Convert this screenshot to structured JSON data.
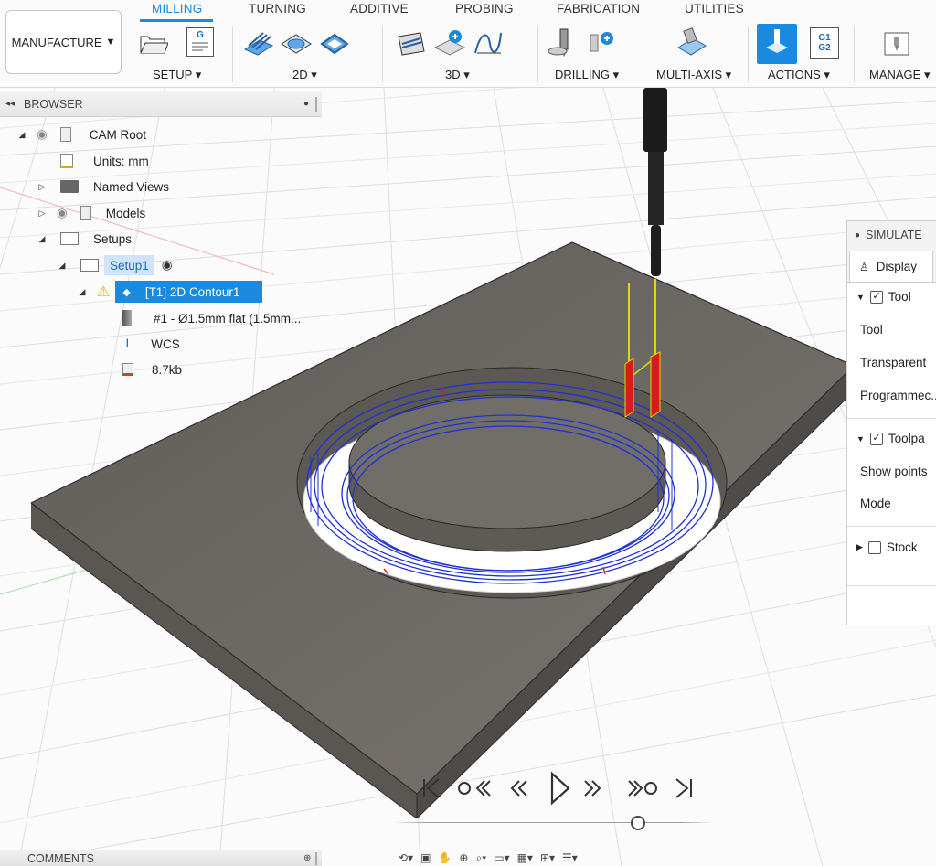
{
  "workspace": {
    "label": "MANUFACTURE"
  },
  "tabs": [
    {
      "label": "MILLING"
    },
    {
      "label": "TURNING"
    },
    {
      "label": "ADDITIVE"
    },
    {
      "label": "PROBING"
    },
    {
      "label": "FABRICATION"
    },
    {
      "label": "UTILITIES"
    }
  ],
  "groups": {
    "setup": "SETUP ▾",
    "twod": "2D ▾",
    "threed": "3D ▾",
    "drilling": "DRILLING ▾",
    "multiaxis": "MULTI-AXIS ▾",
    "actions": "ACTIONS ▾",
    "manage": "MANAGE ▾"
  },
  "icons": {
    "post_g": "G",
    "gcode": "G1 G2"
  },
  "browser": {
    "title": "BROWSER",
    "items": [
      {
        "label": "CAM Root"
      },
      {
        "label": "Units: mm"
      },
      {
        "label": "Named Views"
      },
      {
        "label": "Models"
      },
      {
        "label": "Setups"
      },
      {
        "label": "Setup1"
      },
      {
        "label": "[T1] 2D Contour1"
      },
      {
        "label": "#1 - Ø1.5mm flat (1.5mm..."
      },
      {
        "label": "WCS"
      },
      {
        "label": "8.7kb"
      }
    ]
  },
  "simulate": {
    "title": "SIMULATE",
    "tab": "Display",
    "tool_section": "Tool",
    "rows": [
      "Tool",
      "Transparent",
      "Programmec..."
    ],
    "toolpath_section": "Toolpa",
    "rows2": [
      "Show points",
      "Mode"
    ],
    "stock_section": "Stock",
    "tool_checked": true,
    "toolpath_checked": true,
    "stock_checked": false
  },
  "comments": {
    "label": "COMMENTS"
  },
  "colors": {
    "accent": "#1a8ae0",
    "stock": "#6f6b66",
    "toolpath": "#1f2fd6",
    "warning": "#f5d000"
  }
}
